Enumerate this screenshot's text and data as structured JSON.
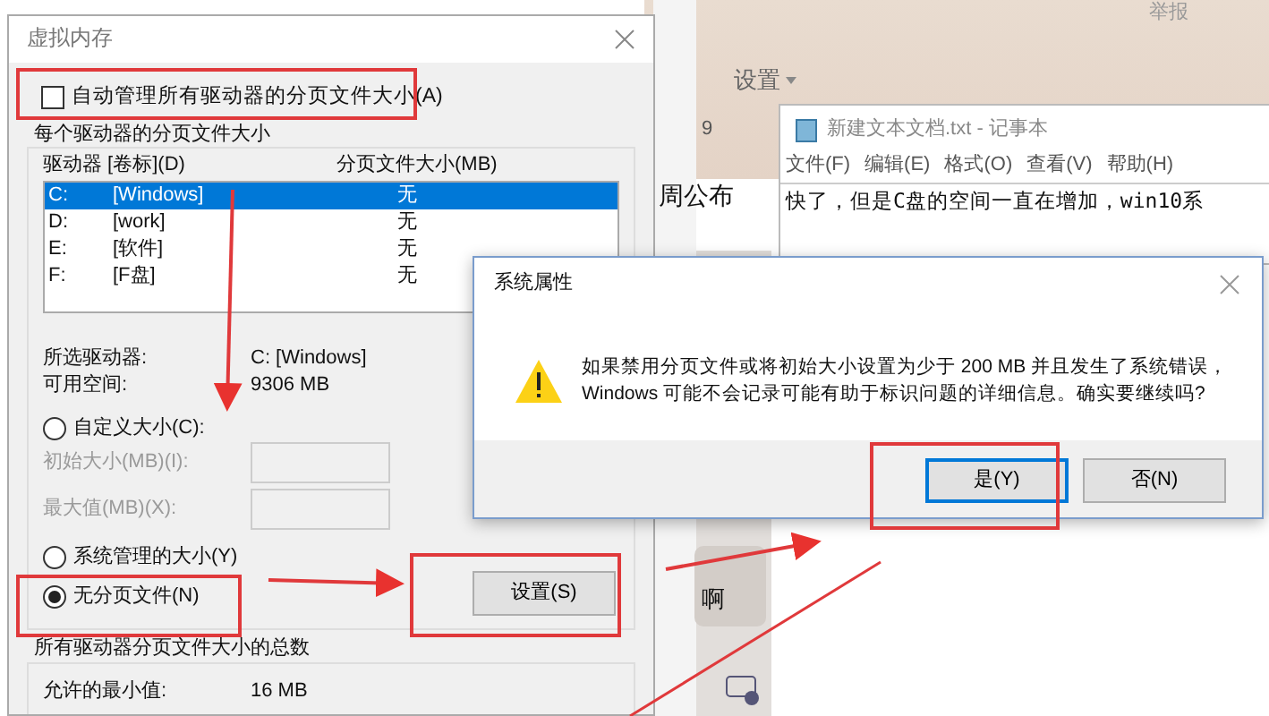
{
  "background_app": {
    "report_link": "举报",
    "settings_menu": "设置",
    "side_number": "9",
    "side_text": "周公布",
    "bubble_text": "啊"
  },
  "virtual_memory": {
    "title": "虚拟内存",
    "auto_manage": {
      "label": "自动管理所有驱动器的分页文件大小(A)",
      "checked": false
    },
    "group_title": "每个驱动器的分页文件大小",
    "columns": [
      "驱动器 [卷标](D)",
      "分页文件大小(MB)"
    ],
    "drives": [
      {
        "letter": "C:",
        "label": "[Windows]",
        "size": "无",
        "selected": true
      },
      {
        "letter": "D:",
        "label": "[work]",
        "size": "无",
        "selected": false
      },
      {
        "letter": "E:",
        "label": "[软件]",
        "size": "无",
        "selected": false
      },
      {
        "letter": "F:",
        "label": "[F盘]",
        "size": "无",
        "selected": false
      }
    ],
    "selected_drive_label": "所选驱动器:",
    "selected_drive": "C:  [Windows]",
    "free_space_label": "可用空间:",
    "free_space": "9306 MB",
    "options": [
      {
        "label": "自定义大小(C):",
        "selected": false
      },
      {
        "label": "系统管理的大小(Y)",
        "selected": false
      },
      {
        "label": "无分页文件(N)",
        "selected": true
      }
    ],
    "initial_size": {
      "label": "初始大小(MB)(I):",
      "disabled": true
    },
    "max_size": {
      "label": "最大值(MB)(X):",
      "disabled": true
    },
    "set_button": "设置(S)",
    "total_title": "所有驱动器分页文件大小的总数",
    "min_allowed_label": "允许的最小值:",
    "min_allowed": "16 MB"
  },
  "notepad": {
    "title": "新建文本文档.txt - 记事本",
    "menu": [
      "文件(F)",
      "编辑(E)",
      "格式(O)",
      "查看(V)",
      "帮助(H)"
    ],
    "text": "快了，但是C盘的空间一直在增加，win10系"
  },
  "system_dialog": {
    "title": "系统属性",
    "message_lines": [
      "如果禁用分页文件或将初始大小设置为少于 200 MB 并且发生了系统错误，",
      "Windows 可能不会记录可能有助于标识问题的详细信息。确实要继续吗?"
    ],
    "buttons": [
      {
        "label": "是(Y)",
        "focused": true
      },
      {
        "label": "否(N)",
        "focused": false
      }
    ]
  }
}
